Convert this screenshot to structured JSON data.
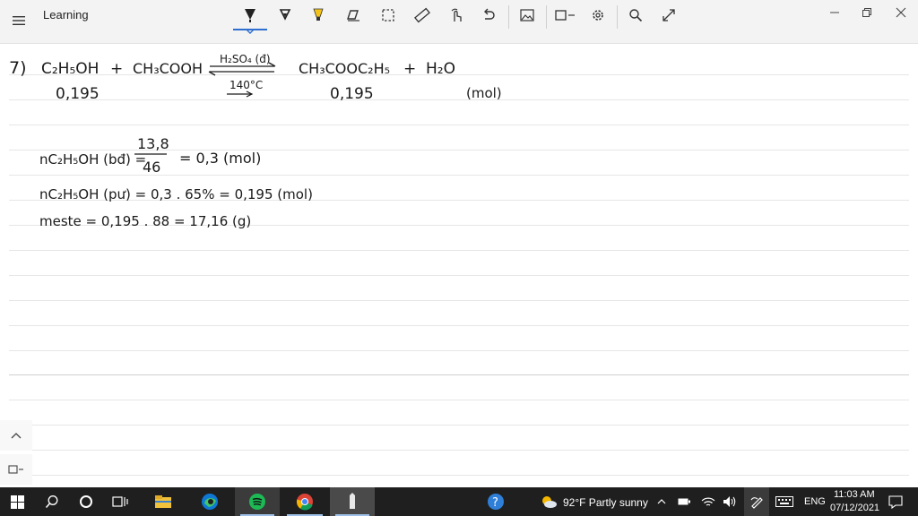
{
  "app": {
    "title": "Learning"
  },
  "toolbar": {
    "tools": [
      "ballpoint-pen-icon",
      "pencil-icon",
      "highlighter-icon",
      "eraser-icon",
      "lasso-select-icon",
      "ruler-icon",
      "touch-writing-icon",
      "undo-icon",
      "image-icon",
      "shape-icon",
      "settings-icon",
      "search-icon",
      "expand-icon"
    ]
  },
  "window_controls": [
    "minimize-icon",
    "maximize-icon",
    "close-icon"
  ],
  "note": {
    "problem_number": "7)",
    "reaction": {
      "reactant1": "C₂H₅OH",
      "plus1": "+",
      "reactant2": "CH₃COOH",
      "condition_top": "H₂SO₄ (đ)",
      "condition_bottom": "140°C",
      "product1": "CH₃COOC₂H₅",
      "plus2": "+",
      "product2": "H₂O",
      "amount1": "0,195",
      "amount2": "0,195",
      "unit": "(mol)"
    },
    "line1_lhs": "nC₂H₅OH (bđ) =",
    "line1_num": "13,8",
    "line1_den": "46",
    "line1_rhs": "= 0,3 (mol)",
    "line2": "nC₂H₅OH (pư) = 0,3 . 65% = 0,195 (mol)",
    "line3": "meste = 0,195 . 88 = 17,16 (g)"
  },
  "taskbar": {
    "weather": "92°F  Partly sunny",
    "language": "ENG",
    "time": "11:03 AM",
    "date": "07/12/2021"
  },
  "colors": {
    "accent": "#2f6fcf",
    "highlighter": "#f2c21a",
    "spotify": "#1db954",
    "taskbar": "#1f1f1f"
  }
}
